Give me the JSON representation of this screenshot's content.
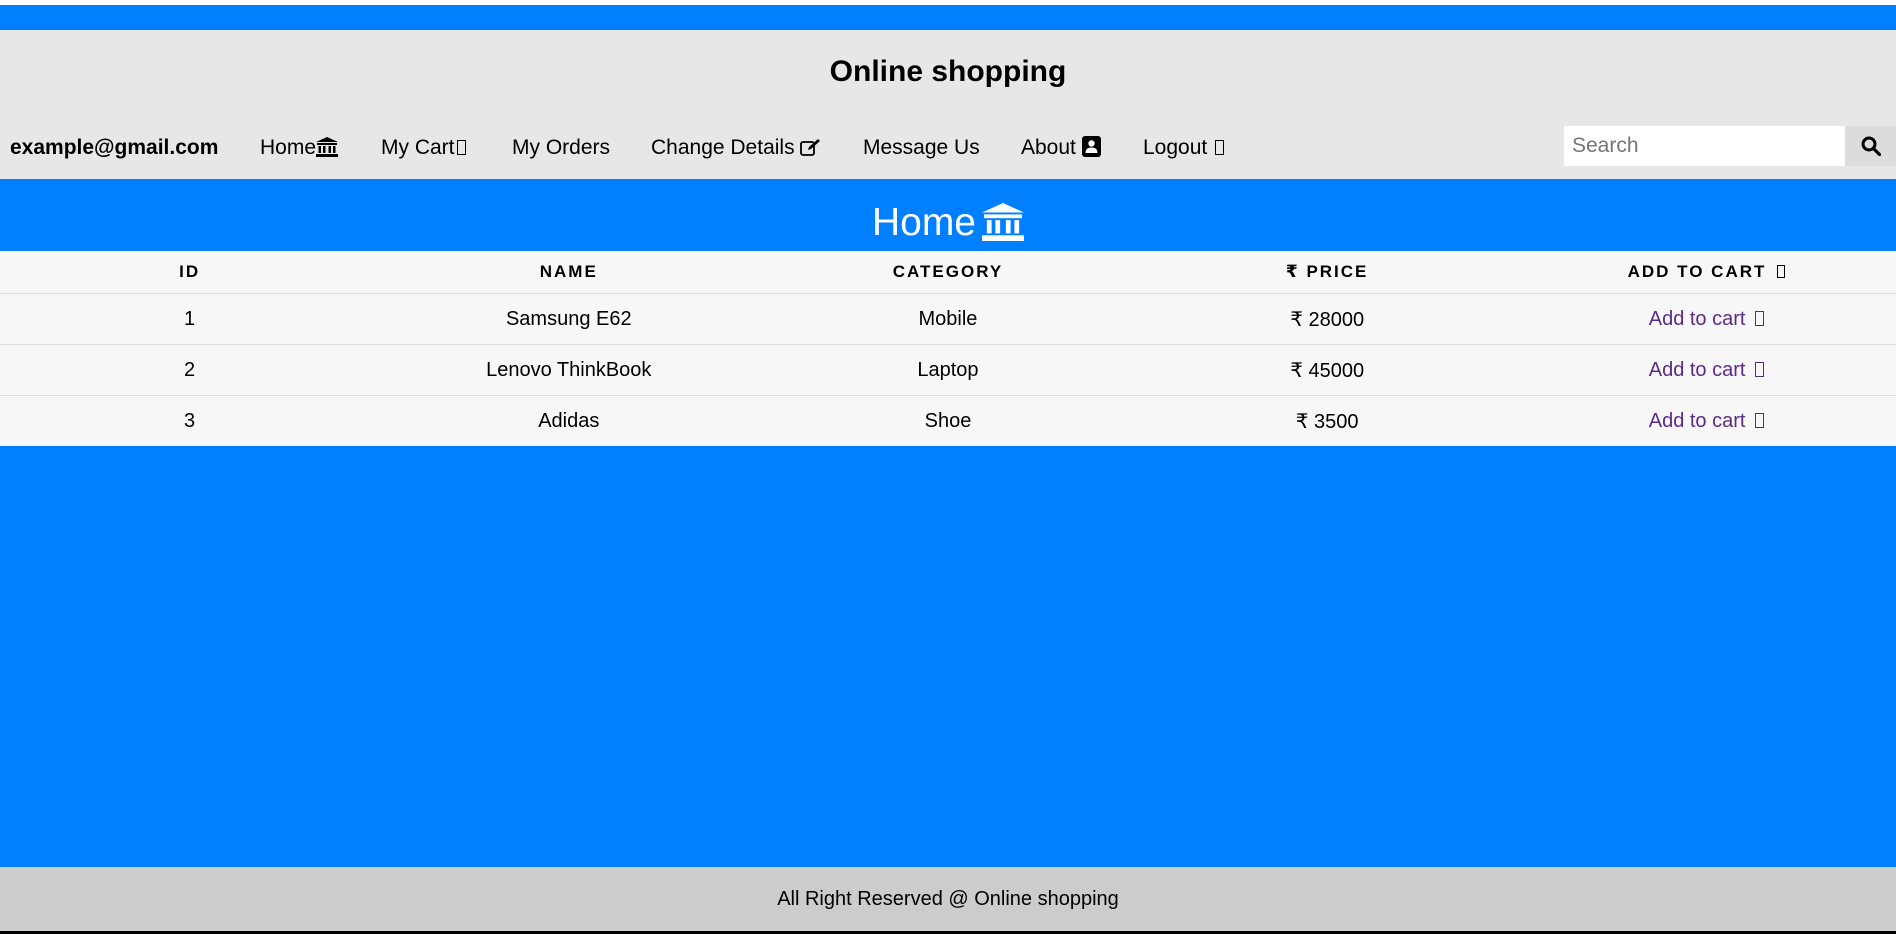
{
  "header": {
    "title": "Online shopping"
  },
  "nav": {
    "email": "example@gmail.com",
    "items": [
      {
        "label": "Home",
        "icon": "bank-icon"
      },
      {
        "label": "My Cart",
        "icon": "cart-icon"
      },
      {
        "label": "My Orders",
        "icon": ""
      },
      {
        "label": "Change Details",
        "icon": "edit-icon"
      },
      {
        "label": "Message Us",
        "icon": ""
      },
      {
        "label": "About",
        "icon": "address-book-icon"
      },
      {
        "label": "Logout",
        "icon": "sign-out-icon"
      }
    ],
    "search": {
      "placeholder": "Search",
      "value": "",
      "button_icon": "search-icon"
    }
  },
  "main": {
    "heading": "Home",
    "heading_icon": "bank-icon",
    "table": {
      "columns": [
        "ID",
        "NAME",
        "CATEGORY",
        "₹ PRICE",
        "ADD TO CART"
      ],
      "rows": [
        {
          "id": "1",
          "name": "Samsung E62",
          "category": "Mobile",
          "price": "₹ 28000",
          "action": "Add to cart"
        },
        {
          "id": "2",
          "name": "Lenovo ThinkBook",
          "category": "Laptop",
          "price": "₹ 45000",
          "action": "Add to cart"
        },
        {
          "id": "3",
          "name": "Adidas",
          "category": "Shoe",
          "price": "₹ 3500",
          "action": "Add to cart"
        }
      ]
    }
  },
  "footer": {
    "text": "All Right Reserved @ Online shopping"
  },
  "colors": {
    "accent_blue": "#007fff",
    "header_bg": "#e7e7e7",
    "footer_bg": "#cccccc",
    "link_purple": "#5b2a86"
  }
}
